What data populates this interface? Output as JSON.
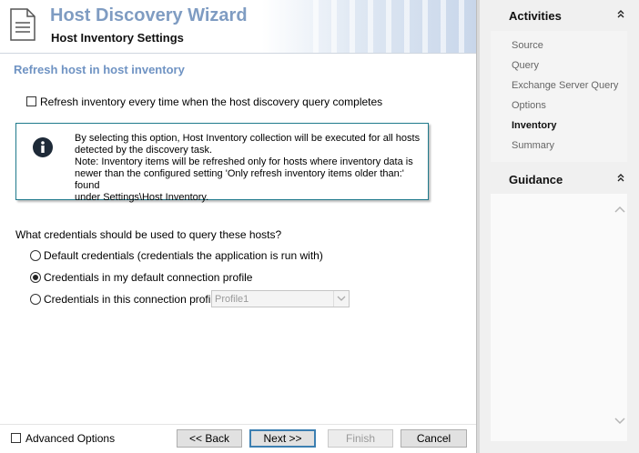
{
  "wizard": {
    "title": "Host Discovery Wizard",
    "subtitle": "Host Inventory Settings"
  },
  "section_title": "Refresh host in host inventory",
  "refresh_checkbox": {
    "label": "Refresh inventory every time when the host discovery query completes",
    "checked": false
  },
  "info": {
    "line1": "By selecting this option, Host Inventory collection will be executed for all hosts",
    "line2": "detected by the discovery task.",
    "line3": "Note: Inventory items will be refreshed only for hosts where inventory data is",
    "line4": "newer than the configured setting  'Only refresh inventory items older than:' found",
    "line5": "under Settings\\Host Inventory."
  },
  "credentials": {
    "question": "What credentials should be used to query these hosts?",
    "options": [
      {
        "label": "Default credentials (credentials the application is run with)",
        "checked": false
      },
      {
        "label": "Credentials in my default connection profile",
        "checked": true
      },
      {
        "label": "Credentials in this connection profile:",
        "checked": false
      }
    ],
    "profile_select": {
      "value": "Profile1",
      "enabled": false
    }
  },
  "footer": {
    "advanced_label": "Advanced Options",
    "back_label": "<< Back",
    "next_label": "Next >>",
    "finish_label": "Finish",
    "cancel_label": "Cancel"
  },
  "activities": {
    "title": "Activities",
    "items": [
      {
        "label": "Source",
        "active": false
      },
      {
        "label": "Query",
        "active": false
      },
      {
        "label": "Exchange Server Query",
        "active": false
      },
      {
        "label": "Options",
        "active": false
      },
      {
        "label": "Inventory",
        "active": true
      },
      {
        "label": "Summary",
        "active": false
      }
    ]
  },
  "guidance": {
    "title": "Guidance"
  },
  "icons": {
    "collapse": "double-chevron-up-icon",
    "info": "info-icon",
    "document": "document-icon"
  },
  "colors": {
    "title_blue": "#7f9cc2",
    "section_blue": "#6f93c3",
    "info_border": "#1f7a8c"
  }
}
